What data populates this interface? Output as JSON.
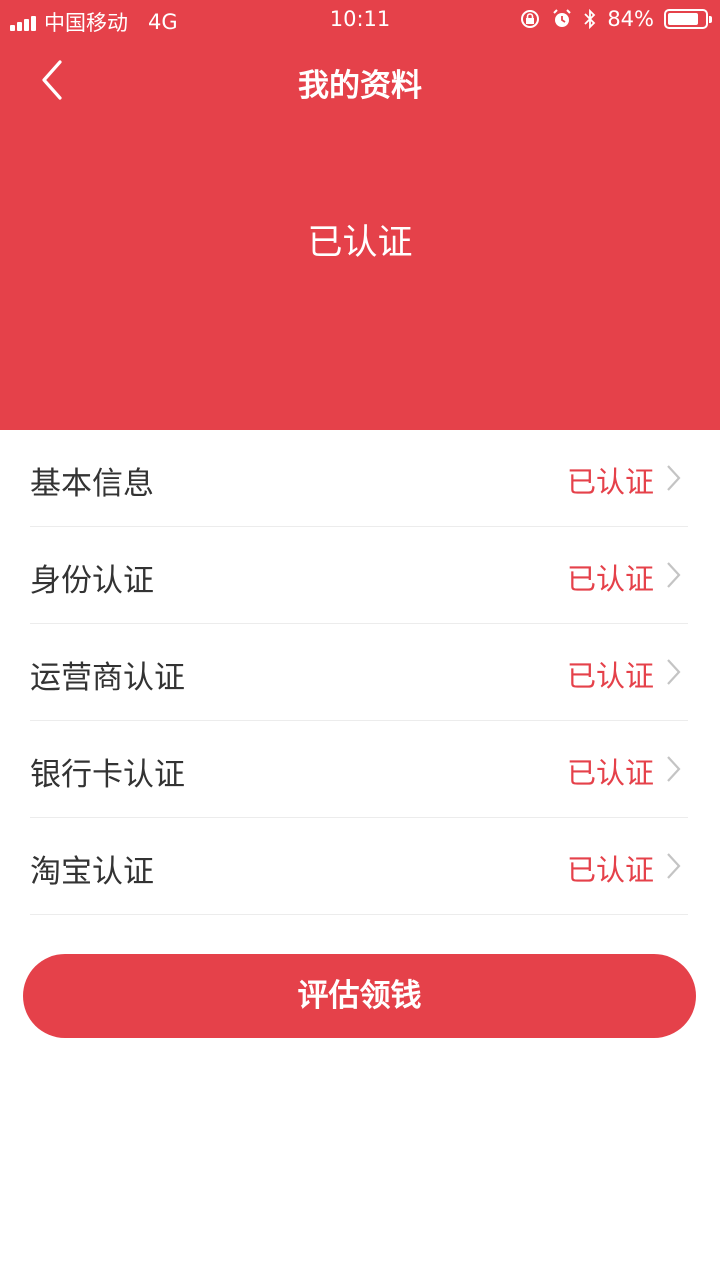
{
  "status_bar": {
    "carrier": "中国移动",
    "network": "4G",
    "time": "10:11",
    "battery_percent": "84%",
    "battery_level": 0.84
  },
  "nav": {
    "title": "我的资料",
    "back_icon": "chevron-left-icon"
  },
  "header": {
    "status": "已认证",
    "background_color": "#e5414a"
  },
  "items": [
    {
      "label": "基本信息",
      "status": "已认证"
    },
    {
      "label": "身份认证",
      "status": "已认证"
    },
    {
      "label": "运营商认证",
      "status": "已认证"
    },
    {
      "label": "银行卡认证",
      "status": "已认证"
    },
    {
      "label": "淘宝认证",
      "status": "已认证"
    }
  ],
  "action_button": {
    "label": "评估领钱"
  }
}
